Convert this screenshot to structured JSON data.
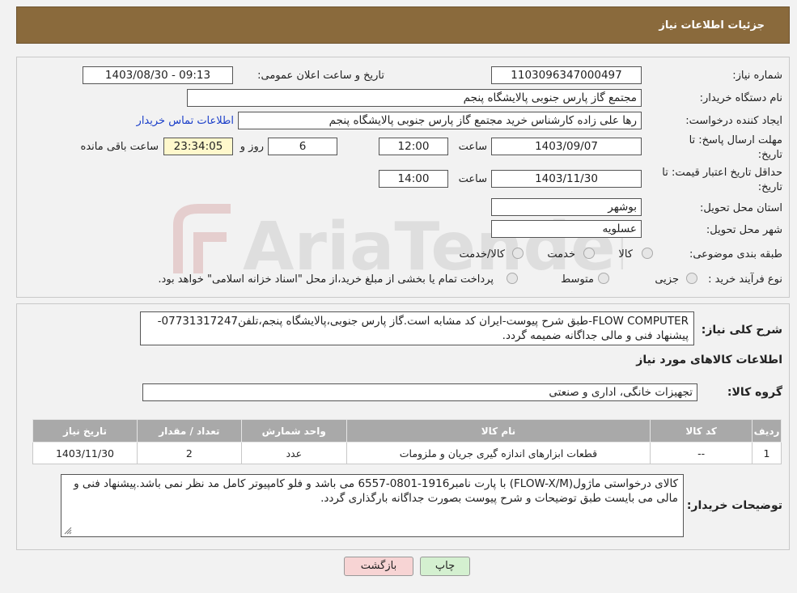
{
  "header": {
    "title": "جزئیات اطلاعات نیاز"
  },
  "fields": {
    "need_number_label": "شماره نیاز:",
    "need_number": "1103096347000497",
    "announce_label": "تاریخ و ساعت اعلان عمومی:",
    "announce_value": "1403/08/30 - 09:13",
    "buyer_org_label": "نام دستگاه خریدار:",
    "buyer_org": "مجتمع گاز پارس جنوبی  پالایشگاه پنجم",
    "requester_label": "ایجاد کننده درخواست:",
    "requester": "رها علی زاده کارشناس خرید مجتمع گاز پارس جنوبی  پالایشگاه پنجم",
    "contact_link": "اطلاعات تماس خریدار",
    "deadline_label_1": "مهلت ارسال پاسخ: تا",
    "deadline_label_2": "تاریخ:",
    "deadline_date": "1403/09/07",
    "time_label": "ساعت",
    "deadline_time": "12:00",
    "days_value": "6",
    "days_label": "روز و",
    "remaining_time": "23:34:05",
    "remaining_label": "ساعت باقی مانده",
    "price_valid_label_1": "حداقل تاریخ اعتبار قیمت: تا",
    "price_valid_label_2": "تاریخ:",
    "price_valid_date": "1403/11/30",
    "price_valid_time": "14:00",
    "province_label": "استان محل تحویل:",
    "province": "بوشهر",
    "city_label": "شهر محل تحویل:",
    "city": "عسلویه",
    "category_label": "طبقه بندی موضوعی:",
    "category_options": [
      "کالا",
      "خدمت",
      "کالا/خدمت"
    ],
    "process_label": "نوع فرآیند خرید :",
    "process_options": [
      "جزیی",
      "متوسط"
    ],
    "process_note": "پرداخت تمام یا بخشی از مبلغ خرید،از محل \"اسناد خزانه اسلامی\" خواهد بود."
  },
  "description": {
    "label": "شرح کلی نیاز:",
    "text": "FLOW COMPUTER-طبق شرح پیوست-ایران کد مشابه است.گاز پارس جنوبی،پالایشگاه پنجم،تلفن07731317247-پیشنهاد فنی و مالی جداگانه ضمیمه گردد."
  },
  "items_section": {
    "title": "اطلاعات کالاهای مورد نیاز",
    "group_label": "گروه کالا:",
    "group_value": "تجهیزات خانگی، اداری و صنعتی"
  },
  "table": {
    "headers": [
      "ردیف",
      "کد کالا",
      "نام کالا",
      "واحد شمارش",
      "تعداد / مقدار",
      "تاریخ نیاز"
    ],
    "rows": [
      [
        "1",
        "--",
        "قطعات ابزارهای اندازه گیری جریان و ملزومات",
        "عدد",
        "2",
        "1403/11/30"
      ]
    ]
  },
  "buyer_notes": {
    "label": "توضیحات خریدار:",
    "text": "کالای درخواستی ماژول(FLOW-X/M) با پارت نامبر1916-0801-6557 می باشد و فلو کامپیوتر کامل مد نظر نمی باشد.پیشنهاد فنی و مالی می بایست طبق توضیحات و شرح پیوست بصورت جداگانه بارگذاری گردد."
  },
  "buttons": {
    "print": "چاپ",
    "back": "بازگشت"
  },
  "watermark": {
    "text": "AriaTender.neT"
  },
  "colors": {
    "header": "#8a6a3c",
    "link": "#1a3ec9",
    "table_header": "#a9a9a9",
    "back_button": "#f7d4d4",
    "print_button": "#d4f0d0"
  }
}
